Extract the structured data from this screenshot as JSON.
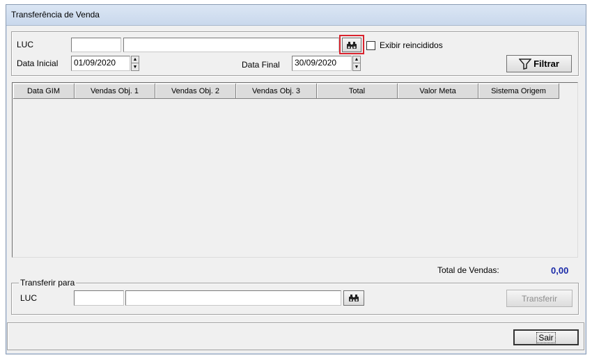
{
  "window": {
    "title": "Transferência de Venda"
  },
  "filter": {
    "luc_label": "LUC",
    "luc_code": "",
    "luc_name": "",
    "search_icon": "binoculars-icon",
    "exibir_reincididos_label": "Exibir reincididos",
    "exibir_reincididos_checked": false,
    "data_inicial_label": "Data Inicial",
    "data_inicial_value": "01/09/2020",
    "data_final_label": "Data Final",
    "data_final_value": "30/09/2020",
    "filtrar_label": "Filtrar",
    "filtrar_icon": "funnel-icon"
  },
  "grid": {
    "columns": [
      "Data GIM",
      "Vendas Obj. 1",
      "Vendas Obj. 2",
      "Vendas Obj. 3",
      "Total",
      "Valor Meta",
      "Sistema Origem"
    ],
    "rows": []
  },
  "totals": {
    "label": "Total de Vendas:",
    "value": "0,00",
    "value_color": "#1a2aa8"
  },
  "transfer": {
    "group_label": "Transferir para",
    "luc_label": "LUC",
    "luc_code": "",
    "luc_name": "",
    "search_icon": "binoculars-icon",
    "transferir_label": "Transferir",
    "transferir_enabled": false
  },
  "footer": {
    "sair_label": "Sair"
  },
  "colors": {
    "highlight": "#d9232e"
  }
}
